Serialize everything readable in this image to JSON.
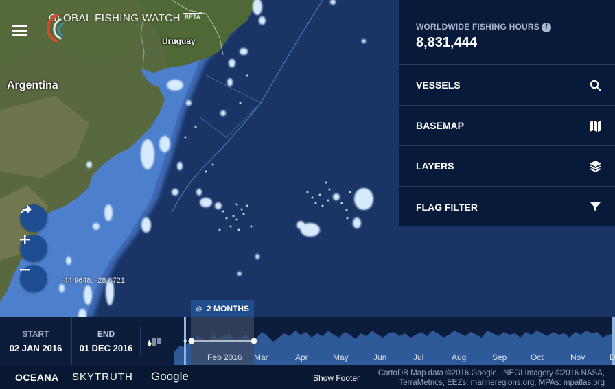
{
  "header": {
    "brand_name": "GLOBAL FISHING WATCH",
    "brand_badge": "BETA"
  },
  "map": {
    "labels": {
      "argentina": "Argentina",
      "uruguay": "Uruguay"
    },
    "cursor_coordinates": "-44.9648, -28.4721"
  },
  "panel": {
    "hours_label": "WORLDWIDE FISHING HOURS",
    "hours_value": "8,831,444",
    "rows": [
      {
        "label": "VESSELS",
        "icon": "search-icon"
      },
      {
        "label": "BASEMAP",
        "icon": "map-icon"
      },
      {
        "label": "LAYERS",
        "icon": "layers-icon"
      },
      {
        "label": "FLAG FILTER",
        "icon": "filter-icon"
      }
    ]
  },
  "timeline": {
    "start_label": "START",
    "start_value": "02 JAN 2016",
    "end_label": "END",
    "end_value": "01 DEC 2016",
    "range_label": "2 MONTHS",
    "months": [
      "Feb 2016",
      "Mar",
      "Apr",
      "May",
      "Jun",
      "Jul",
      "Aug",
      "Sep",
      "Oct",
      "Nov",
      "D"
    ]
  },
  "footer": {
    "partners": [
      "OCEANA",
      "SKYTRUTH",
      "Google"
    ],
    "show_footer": "Show Footer",
    "attribution_line1": "CartoDB Map data ©2016 Google, INEGI Imagery ©2016 NASA,",
    "attribution_line2": "TerraMetrics, EEZs: marineregions.org, MPAs: mpatlas.org"
  },
  "colors": {
    "panel_bg": "#081a3a",
    "accent": "#204e8c",
    "ocean": "#1b356a",
    "activity": "#cfe6ff"
  }
}
